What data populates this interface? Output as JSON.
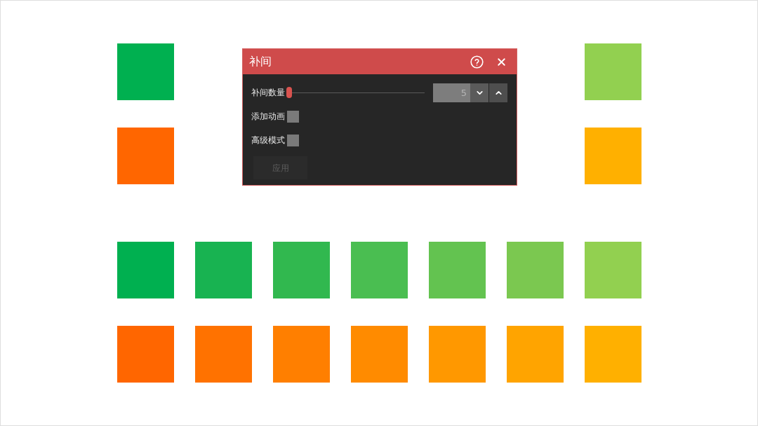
{
  "slide": {
    "corner_rows": [
      {
        "left": {
          "color": "#00b050"
        },
        "right": {
          "color": "#92d050"
        }
      },
      {
        "left": {
          "color": "#ff6600"
        },
        "right": {
          "color": "#ffb000"
        }
      }
    ],
    "tween_rows": [
      {
        "squares": [
          {
            "color": "#00b050"
          },
          {
            "color": "#18b351"
          },
          {
            "color": "#31b84f"
          },
          {
            "color": "#4abe51"
          },
          {
            "color": "#63c350"
          },
          {
            "color": "#7bc850"
          },
          {
            "color": "#92d050"
          }
        ]
      },
      {
        "squares": [
          {
            "color": "#ff6600"
          },
          {
            "color": "#ff7200"
          },
          {
            "color": "#ff7f00"
          },
          {
            "color": "#ff8b00"
          },
          {
            "color": "#ff9800"
          },
          {
            "color": "#ffa400"
          },
          {
            "color": "#ffb000"
          }
        ]
      }
    ]
  },
  "dialog": {
    "title": "补间",
    "count": {
      "label": "补间数量",
      "level": 0,
      "value": "5"
    },
    "options": [
      {
        "label": "添加动画",
        "checked": false
      },
      {
        "label": "高级模式",
        "checked": false
      }
    ],
    "apply_button": {
      "label": "应用",
      "disabled": true
    }
  }
}
